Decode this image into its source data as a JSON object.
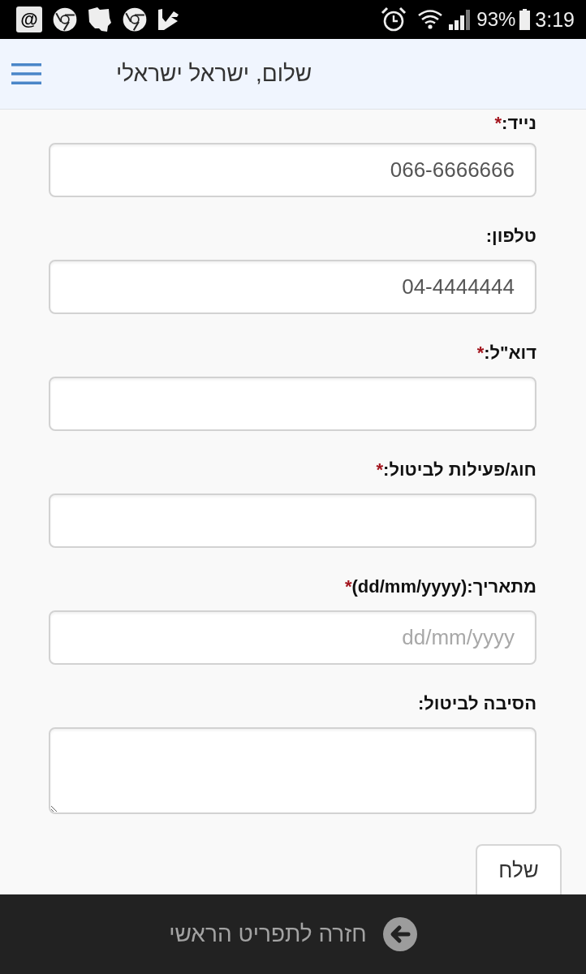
{
  "status_bar": {
    "badge": "@",
    "battery": "93%",
    "time": "3:19"
  },
  "header": {
    "title": "שלום, ישראל ישראלי"
  },
  "form": {
    "fields": [
      {
        "kind": "input",
        "label": "נייד:",
        "required_mark": "*",
        "value": "066-6666666"
      },
      {
        "kind": "input",
        "label": "טלפון:",
        "value": "04-4444444"
      },
      {
        "kind": "input",
        "label": "דוא\"ל:",
        "required_mark": "*"
      },
      {
        "kind": "input",
        "label": "חוג/פעילות לביטול:",
        "required_mark": "*"
      },
      {
        "kind": "input",
        "label": "מתאריך:(dd/mm/yyyy)",
        "required_mark": "*",
        "placeholder": "dd/mm/yyyy"
      },
      {
        "kind": "textarea",
        "label": "הסיבה לביטול:"
      }
    ],
    "submit": "שלח"
  },
  "bottom_bar": {
    "back_link": "חזרה לתפריט הראשי"
  }
}
